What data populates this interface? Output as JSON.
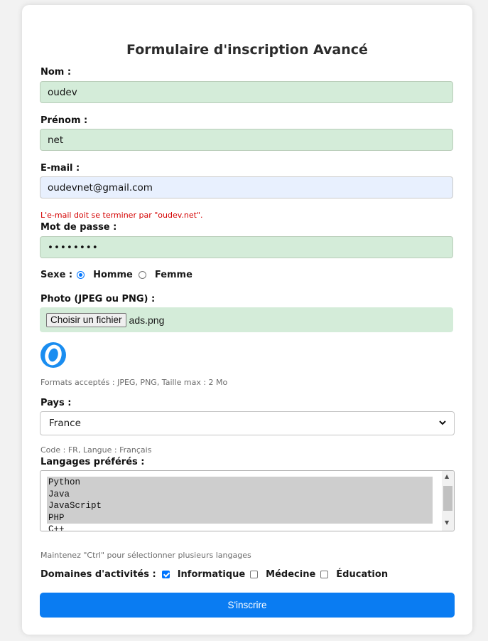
{
  "form": {
    "title": "Formulaire d'inscription Avancé",
    "nom": {
      "label": "Nom :",
      "value": "oudev"
    },
    "prenom": {
      "label": "Prénom :",
      "value": "net"
    },
    "email": {
      "label": "E-mail :",
      "value": "oudevnet@gmail.com",
      "error": "L'e-mail doit se terminer par \"oudev.net\"."
    },
    "password": {
      "label": "Mot de passe :",
      "value": "••••••••"
    },
    "sexe": {
      "label": "Sexe :",
      "options": [
        {
          "label": "Homme",
          "checked": true
        },
        {
          "label": "Femme",
          "checked": false
        }
      ]
    },
    "photo": {
      "label": "Photo (JPEG ou PNG) :",
      "button": "Choisir un fichier",
      "filename": "ads.png",
      "hint": "Formats acceptés : JPEG, PNG, Taille max : 2 Mo",
      "preview_letter": "O"
    },
    "pays": {
      "label": "Pays :",
      "selected": "France",
      "info": "Code : FR, Langue : Français"
    },
    "langages": {
      "label": "Langages préférés :",
      "options": [
        "Python",
        "Java",
        "JavaScript",
        "PHP",
        "C++"
      ],
      "selected": [
        "Python",
        "Java",
        "JavaScript",
        "PHP"
      ],
      "hint": "Maintenez \"Ctrl\" pour sélectionner plusieurs langages"
    },
    "domaines": {
      "label": "Domaines d'activités :",
      "options": [
        {
          "label": "Informatique",
          "checked": true
        },
        {
          "label": "Médecine",
          "checked": false
        },
        {
          "label": "Éducation",
          "checked": false
        }
      ]
    },
    "submit": "S'inscrire"
  },
  "colors": {
    "accent": "#0a7cf2",
    "valid_field": "#d4ecd9",
    "autofill_field": "#e8f0fe",
    "error": "#d40000"
  }
}
